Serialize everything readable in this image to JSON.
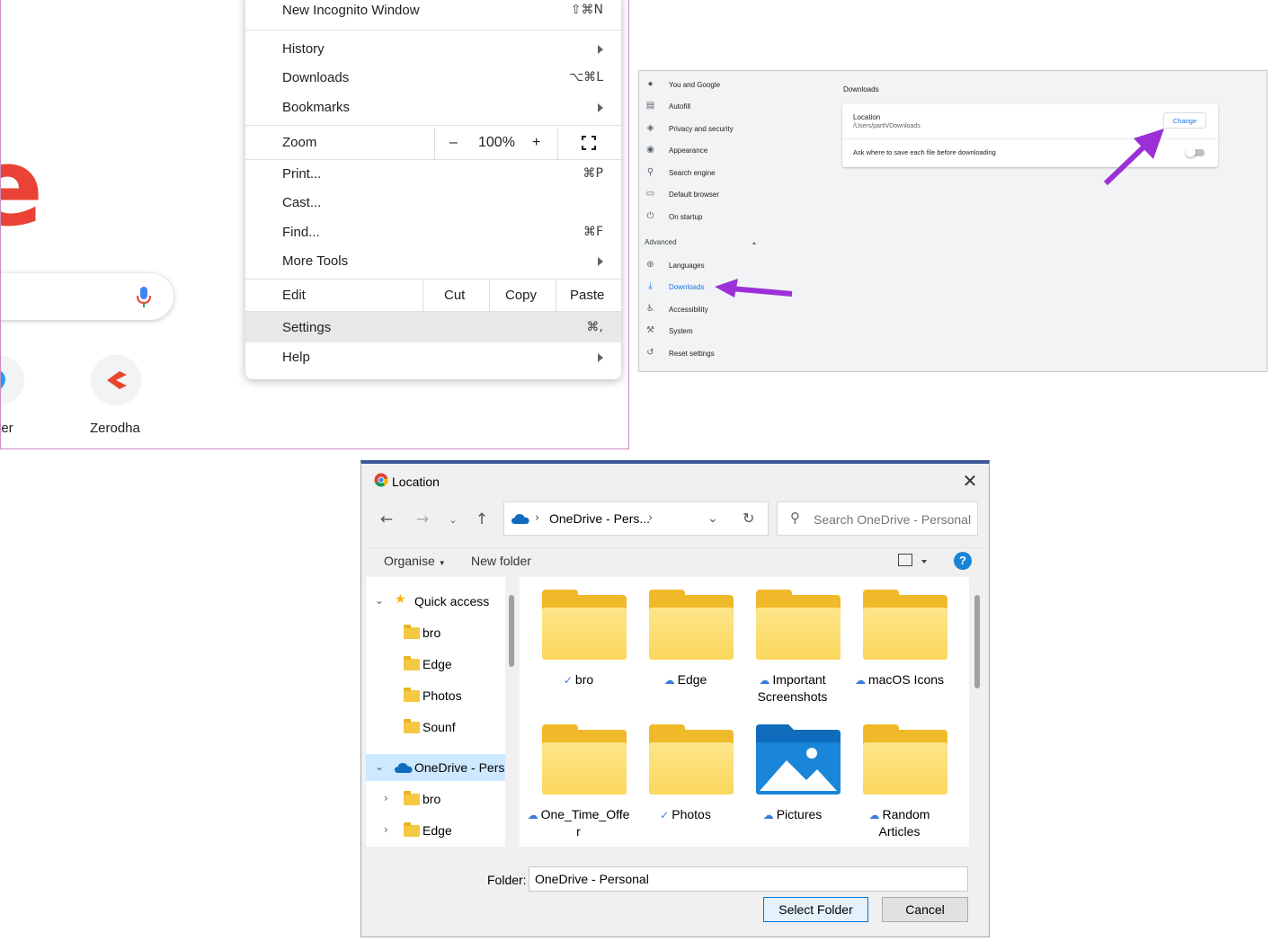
{
  "chrome_menu": {
    "new_incognito": {
      "label": "New Incognito Window",
      "shortcut": "⇧⌘N"
    },
    "history": "History",
    "downloads": {
      "label": "Downloads",
      "shortcut": "⌥⌘L"
    },
    "bookmarks": "Bookmarks",
    "zoom": {
      "label": "Zoom",
      "minus": "–",
      "level": "100%",
      "plus": "+"
    },
    "print": {
      "label": "Print...",
      "shortcut": "⌘P"
    },
    "cast": "Cast...",
    "find": {
      "label": "Find...",
      "shortcut": "⌘F"
    },
    "more_tools": "More Tools",
    "edit": {
      "label": "Edit",
      "cut": "Cut",
      "copy": "Copy",
      "paste": "Paste"
    },
    "settings": {
      "label": "Settings",
      "shortcut": "⌘,"
    },
    "help": "Help"
  },
  "new_tab": {
    "shortcut_left_label": "tter",
    "shortcut_zerodha_label": "Zerodha",
    "colors": {
      "google_red": "#ea4335",
      "zerodha": "#e8462c"
    }
  },
  "settings": {
    "nav": [
      {
        "label": "You and Google",
        "icon": "person-icon"
      },
      {
        "label": "Autofill",
        "icon": "clipboard-icon"
      },
      {
        "label": "Privacy and security",
        "icon": "shield-icon"
      },
      {
        "label": "Appearance",
        "icon": "palette-icon"
      },
      {
        "label": "Search engine",
        "icon": "search-icon"
      },
      {
        "label": "Default browser",
        "icon": "browser-icon"
      },
      {
        "label": "On startup",
        "icon": "power-icon"
      }
    ],
    "advanced_label": "Advanced",
    "advanced_nav": [
      {
        "label": "Languages",
        "icon": "globe-icon"
      },
      {
        "label": "Downloads",
        "icon": "download-icon",
        "active": true
      },
      {
        "label": "Accessibility",
        "icon": "accessibility-icon"
      },
      {
        "label": "System",
        "icon": "wrench-icon"
      },
      {
        "label": "Reset settings",
        "icon": "restore-icon"
      }
    ],
    "section_title": "Downloads",
    "location_title": "Location",
    "location_path": "/Users/parth/Downloads",
    "change_label": "Change",
    "ask_label": "Ask where to save each file before downloading",
    "annotation_color": "#9b30d9",
    "accent_color": "#1a73e8"
  },
  "dialog": {
    "title": "Location",
    "address_path": "OneDrive - Pers...",
    "search_placeholder": "Search OneDrive - Personal",
    "organise": "Organise",
    "new_folder": "New folder",
    "help": "?",
    "tree": {
      "quick_access": "Quick access",
      "quick_items": [
        "bro",
        "Edge",
        "Photos",
        "Sounf"
      ],
      "onedrive": "OneDrive - Perso",
      "onedrive_items": [
        "bro",
        "Edge"
      ]
    },
    "folders": [
      {
        "name": "bro",
        "status": "synced"
      },
      {
        "name": "Edge",
        "status": "cloud"
      },
      {
        "name_line1": "Important",
        "name_line2": "Screenshots",
        "status": "cloud"
      },
      {
        "name": "macOS Icons",
        "status": "cloud"
      },
      {
        "name_line1": "One_Time_Offe",
        "name_line2": "r",
        "status": "cloud"
      },
      {
        "name": "Photos",
        "status": "synced"
      },
      {
        "name": "Pictures",
        "status": "cloud"
      },
      {
        "name_line1": "Random",
        "name_line2": "Articles",
        "status": "cloud"
      }
    ],
    "folder_label": "Folder:",
    "folder_value": "OneDrive - Personal",
    "select_folder": "Select Folder",
    "cancel": "Cancel",
    "colors": {
      "folder": "#f0b929",
      "selection": "#cde8ff",
      "onedrive": "#0f6cbd"
    }
  }
}
